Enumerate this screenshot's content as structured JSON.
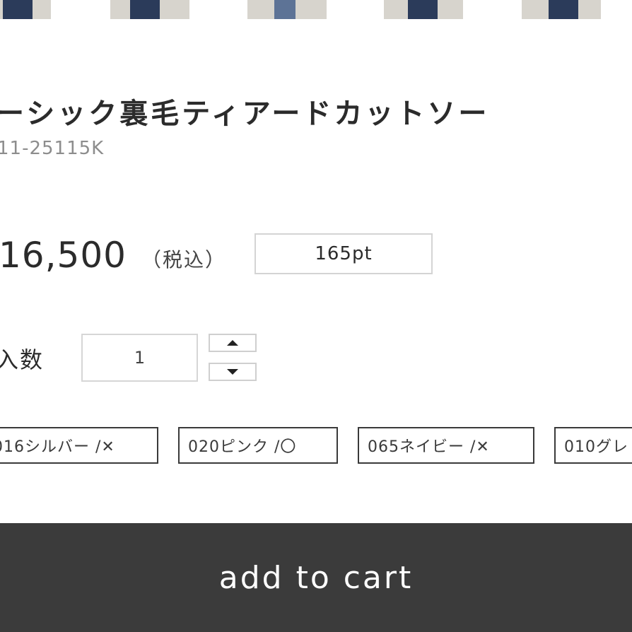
{
  "thumbnails": [
    {
      "icon": "product-photo"
    },
    {
      "icon": "product-photo"
    },
    {
      "icon": "product-photo"
    },
    {
      "icon": "product-photo"
    },
    {
      "icon": "product-photo"
    }
  ],
  "product": {
    "title": "ーシック裏毛ティアードカットソー",
    "sku": "11-25115K",
    "price": "16,500",
    "tax_note": "（税込）",
    "points": "165pt"
  },
  "quantity": {
    "label": "入数",
    "value": "1"
  },
  "colors": [
    {
      "label": "016シルバー /✕"
    },
    {
      "label": "020ピンク /〇"
    },
    {
      "label": "065ネイビー /✕"
    },
    {
      "label": "010グレ"
    }
  ],
  "cart": {
    "label": "add to cart",
    "accent": "#3b3b3b"
  }
}
